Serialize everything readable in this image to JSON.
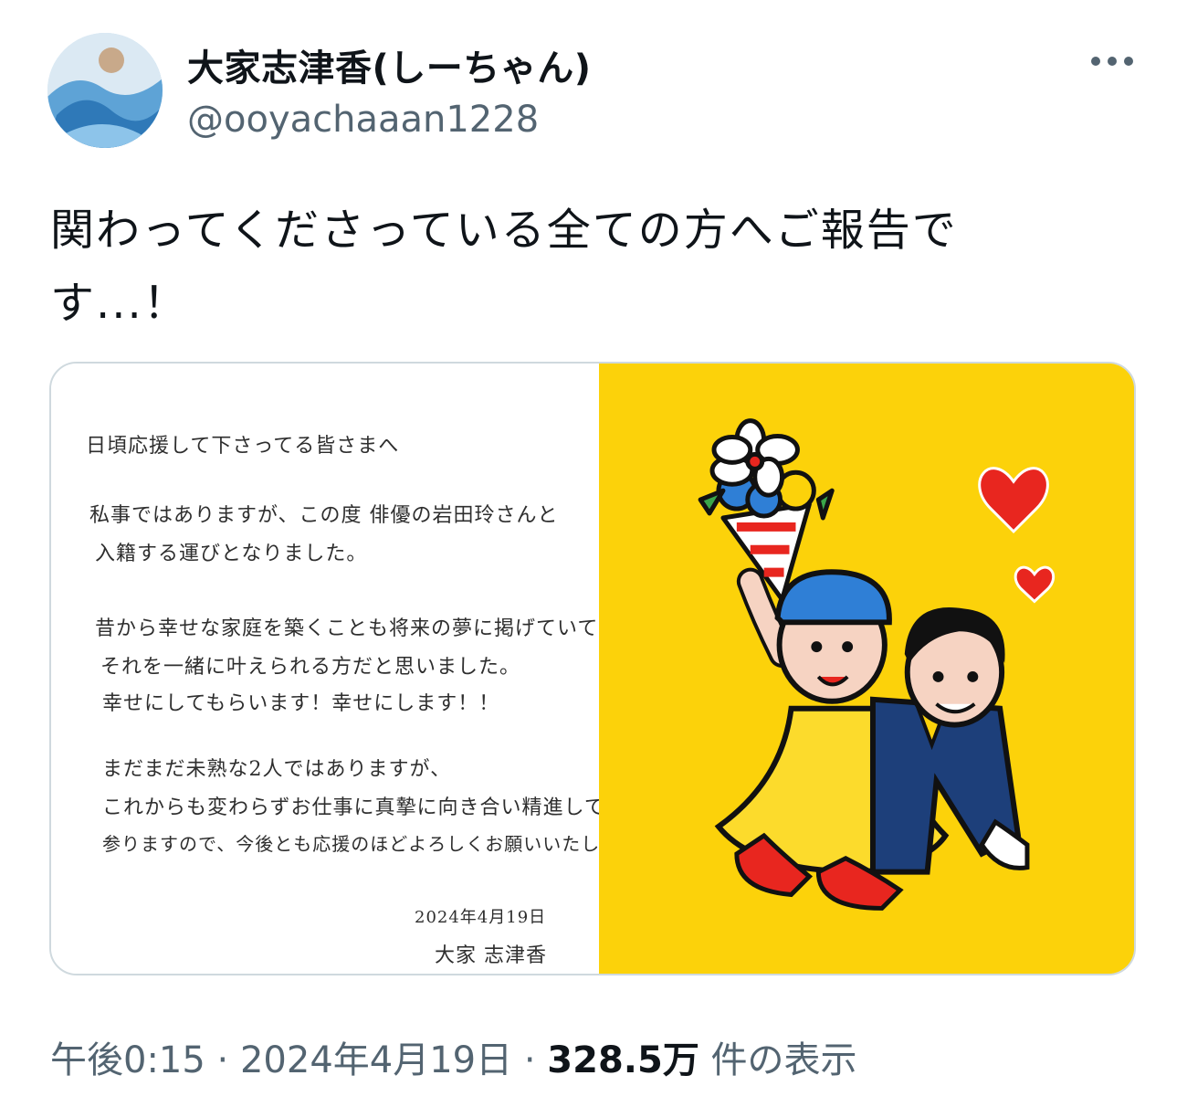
{
  "author": {
    "display_name": "大家志津香(しーちゃん)",
    "handle": "@ooyachaaan1228"
  },
  "tweet": {
    "text_line1": "関わってくださっている全ての方へご報告で",
    "text_line2": "す...！"
  },
  "letter": {
    "greeting": "日頃応援して下さってる皆さまへ",
    "paragraphs": [
      "私事ではありますが、この度 俳優の岩田玲さんと",
      "入籍する運びとなりました。",
      "昔から幸せな家庭を築くことも将来の夢に掲げていて",
      "それを一緒に叶えられる方だと思いました。",
      "幸せにしてもらいます！幸せにします！！",
      "まだまだ未熟な2人ではありますが、",
      "これからも変わらずお仕事に真摯に向き合い精進して",
      "参りますので、今後とも応援のほどよろしくお願いいたします。"
    ],
    "date": "2024年4月19日",
    "signature": "大家 志津香"
  },
  "meta": {
    "time": "午後0:15",
    "separator": " · ",
    "date": "2024年4月19日",
    "views_count": "328.5万",
    "views_label": " 件の表示"
  },
  "colors": {
    "illustration_bg": "#fcd20a",
    "heart": "#e8261f",
    "secondary_text": "#536471"
  }
}
